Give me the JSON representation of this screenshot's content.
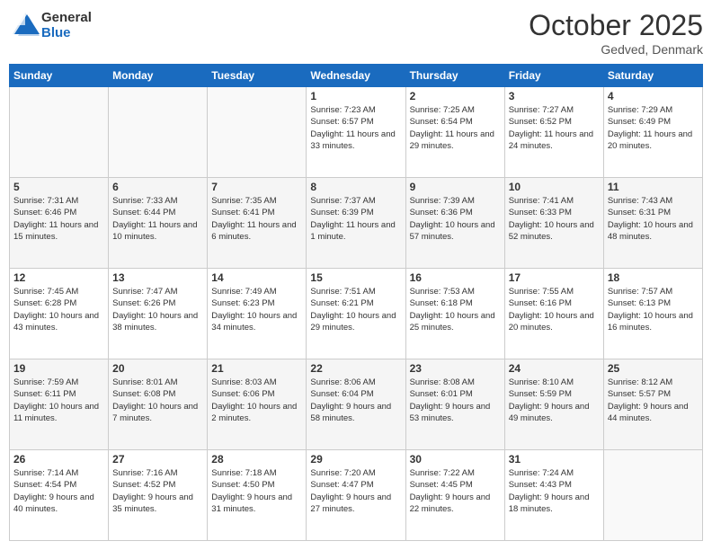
{
  "logo": {
    "general": "General",
    "blue": "Blue"
  },
  "header": {
    "month": "October 2025",
    "location": "Gedved, Denmark"
  },
  "weekdays": [
    "Sunday",
    "Monday",
    "Tuesday",
    "Wednesday",
    "Thursday",
    "Friday",
    "Saturday"
  ],
  "weeks": [
    [
      {
        "day": "",
        "info": ""
      },
      {
        "day": "",
        "info": ""
      },
      {
        "day": "",
        "info": ""
      },
      {
        "day": "1",
        "info": "Sunrise: 7:23 AM\nSunset: 6:57 PM\nDaylight: 11 hours\nand 33 minutes."
      },
      {
        "day": "2",
        "info": "Sunrise: 7:25 AM\nSunset: 6:54 PM\nDaylight: 11 hours\nand 29 minutes."
      },
      {
        "day": "3",
        "info": "Sunrise: 7:27 AM\nSunset: 6:52 PM\nDaylight: 11 hours\nand 24 minutes."
      },
      {
        "day": "4",
        "info": "Sunrise: 7:29 AM\nSunset: 6:49 PM\nDaylight: 11 hours\nand 20 minutes."
      }
    ],
    [
      {
        "day": "5",
        "info": "Sunrise: 7:31 AM\nSunset: 6:46 PM\nDaylight: 11 hours\nand 15 minutes."
      },
      {
        "day": "6",
        "info": "Sunrise: 7:33 AM\nSunset: 6:44 PM\nDaylight: 11 hours\nand 10 minutes."
      },
      {
        "day": "7",
        "info": "Sunrise: 7:35 AM\nSunset: 6:41 PM\nDaylight: 11 hours\nand 6 minutes."
      },
      {
        "day": "8",
        "info": "Sunrise: 7:37 AM\nSunset: 6:39 PM\nDaylight: 11 hours\nand 1 minute."
      },
      {
        "day": "9",
        "info": "Sunrise: 7:39 AM\nSunset: 6:36 PM\nDaylight: 10 hours\nand 57 minutes."
      },
      {
        "day": "10",
        "info": "Sunrise: 7:41 AM\nSunset: 6:33 PM\nDaylight: 10 hours\nand 52 minutes."
      },
      {
        "day": "11",
        "info": "Sunrise: 7:43 AM\nSunset: 6:31 PM\nDaylight: 10 hours\nand 48 minutes."
      }
    ],
    [
      {
        "day": "12",
        "info": "Sunrise: 7:45 AM\nSunset: 6:28 PM\nDaylight: 10 hours\nand 43 minutes."
      },
      {
        "day": "13",
        "info": "Sunrise: 7:47 AM\nSunset: 6:26 PM\nDaylight: 10 hours\nand 38 minutes."
      },
      {
        "day": "14",
        "info": "Sunrise: 7:49 AM\nSunset: 6:23 PM\nDaylight: 10 hours\nand 34 minutes."
      },
      {
        "day": "15",
        "info": "Sunrise: 7:51 AM\nSunset: 6:21 PM\nDaylight: 10 hours\nand 29 minutes."
      },
      {
        "day": "16",
        "info": "Sunrise: 7:53 AM\nSunset: 6:18 PM\nDaylight: 10 hours\nand 25 minutes."
      },
      {
        "day": "17",
        "info": "Sunrise: 7:55 AM\nSunset: 6:16 PM\nDaylight: 10 hours\nand 20 minutes."
      },
      {
        "day": "18",
        "info": "Sunrise: 7:57 AM\nSunset: 6:13 PM\nDaylight: 10 hours\nand 16 minutes."
      }
    ],
    [
      {
        "day": "19",
        "info": "Sunrise: 7:59 AM\nSunset: 6:11 PM\nDaylight: 10 hours\nand 11 minutes."
      },
      {
        "day": "20",
        "info": "Sunrise: 8:01 AM\nSunset: 6:08 PM\nDaylight: 10 hours\nand 7 minutes."
      },
      {
        "day": "21",
        "info": "Sunrise: 8:03 AM\nSunset: 6:06 PM\nDaylight: 10 hours\nand 2 minutes."
      },
      {
        "day": "22",
        "info": "Sunrise: 8:06 AM\nSunset: 6:04 PM\nDaylight: 9 hours\nand 58 minutes."
      },
      {
        "day": "23",
        "info": "Sunrise: 8:08 AM\nSunset: 6:01 PM\nDaylight: 9 hours\nand 53 minutes."
      },
      {
        "day": "24",
        "info": "Sunrise: 8:10 AM\nSunset: 5:59 PM\nDaylight: 9 hours\nand 49 minutes."
      },
      {
        "day": "25",
        "info": "Sunrise: 8:12 AM\nSunset: 5:57 PM\nDaylight: 9 hours\nand 44 minutes."
      }
    ],
    [
      {
        "day": "26",
        "info": "Sunrise: 7:14 AM\nSunset: 4:54 PM\nDaylight: 9 hours\nand 40 minutes."
      },
      {
        "day": "27",
        "info": "Sunrise: 7:16 AM\nSunset: 4:52 PM\nDaylight: 9 hours\nand 35 minutes."
      },
      {
        "day": "28",
        "info": "Sunrise: 7:18 AM\nSunset: 4:50 PM\nDaylight: 9 hours\nand 31 minutes."
      },
      {
        "day": "29",
        "info": "Sunrise: 7:20 AM\nSunset: 4:47 PM\nDaylight: 9 hours\nand 27 minutes."
      },
      {
        "day": "30",
        "info": "Sunrise: 7:22 AM\nSunset: 4:45 PM\nDaylight: 9 hours\nand 22 minutes."
      },
      {
        "day": "31",
        "info": "Sunrise: 7:24 AM\nSunset: 4:43 PM\nDaylight: 9 hours\nand 18 minutes."
      },
      {
        "day": "",
        "info": ""
      }
    ]
  ]
}
